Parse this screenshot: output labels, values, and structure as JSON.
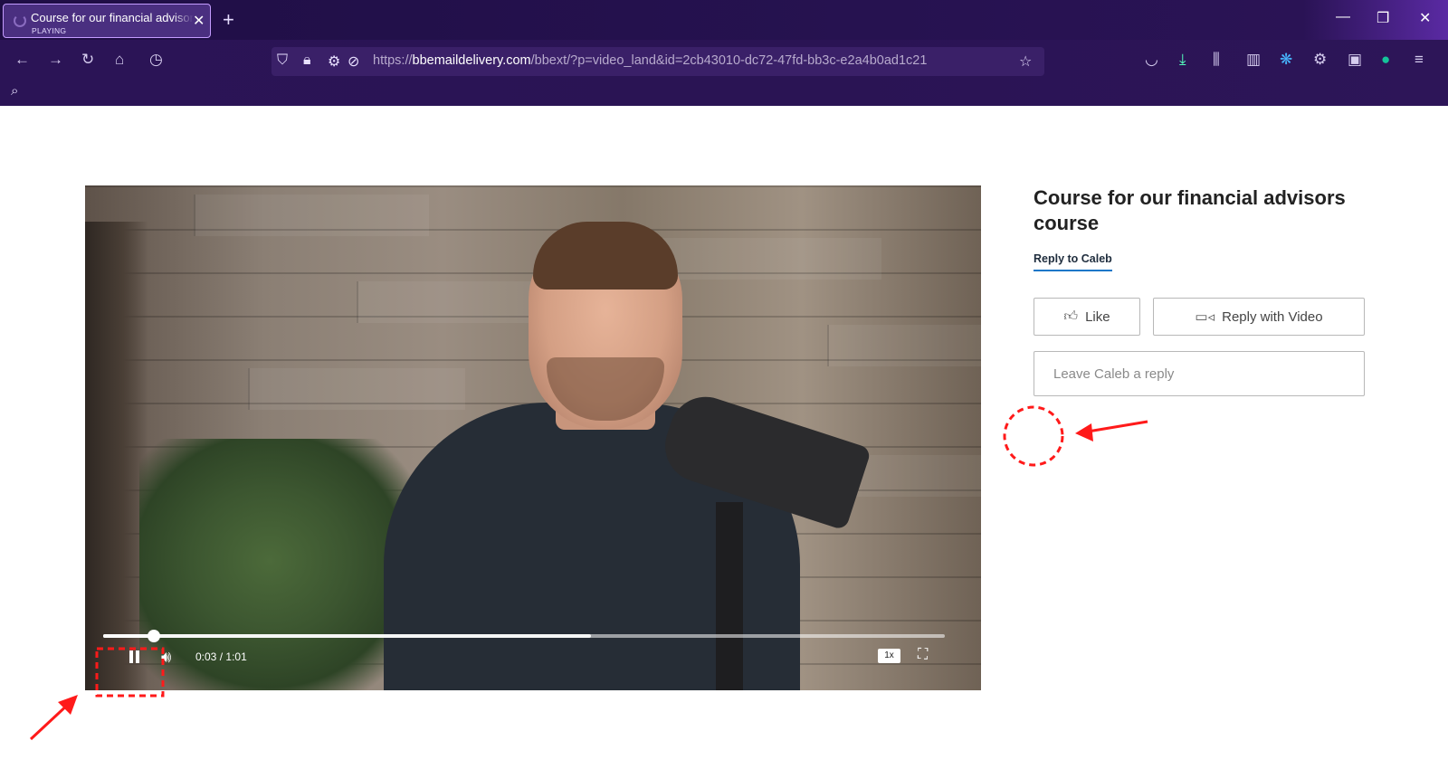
{
  "browser": {
    "tab": {
      "title": "Course for our financial advisors",
      "status": "PLAYING"
    },
    "url": {
      "scheme": "https://",
      "host": "bbemaildelivery.com",
      "path": "/bbext/?p=video_land&id=2cb43010-dc72-47fd-bb3c-e2a4b0ad1c21"
    },
    "icons": [
      "back-icon",
      "forward-icon",
      "reload-icon",
      "home-icon",
      "history-icon",
      "shield-icon",
      "lock-icon",
      "permissions-icon",
      "tracking-icon",
      "bookmark-star-icon",
      "pocket-icon",
      "download-icon",
      "library-icon",
      "sidebar-icon",
      "extension-icon",
      "settings-icon",
      "profile-icon",
      "grammarly-icon",
      "menu-icon",
      "search-icon"
    ]
  },
  "video": {
    "current_time": "0:03",
    "separator": "/",
    "duration": "1:01",
    "played_fraction": 0.06,
    "buffered_fraction": 0.58,
    "speed": "1x"
  },
  "sidebar": {
    "title": "Course for our financial advisors course",
    "reply_tab": "Reply to Caleb",
    "like_label": "Like",
    "reply_video_label": "Reply with Video",
    "reply_placeholder": "Leave Caleb a reply"
  },
  "annotations": {
    "color": "#ff1a1a"
  }
}
